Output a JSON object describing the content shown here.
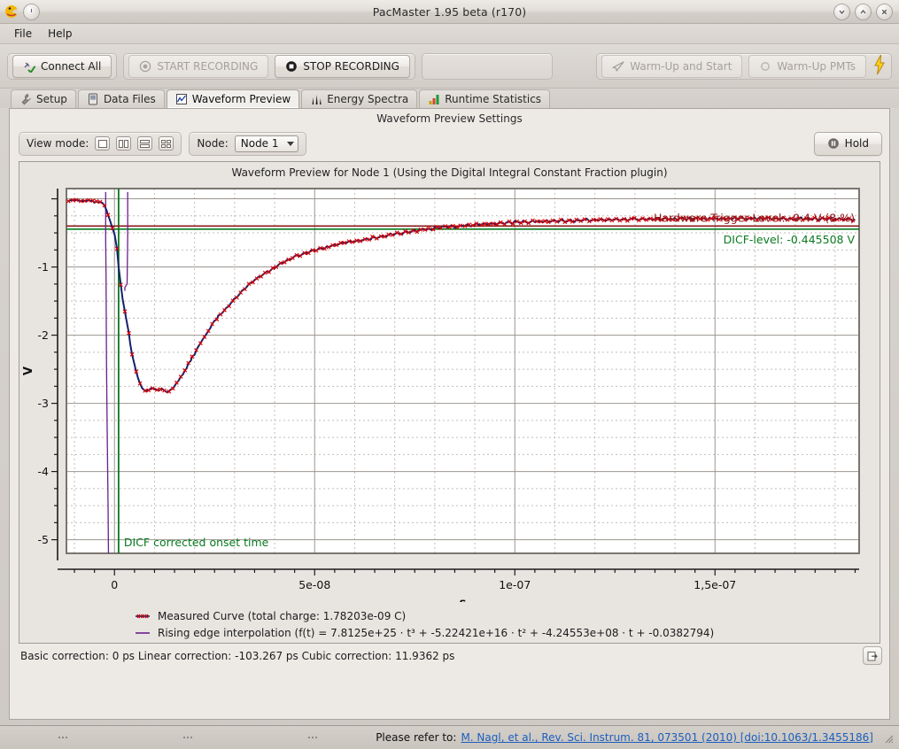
{
  "window": {
    "title": "PacMaster 1.95 beta (r170)",
    "app_icon": "pacman-icon",
    "controls": [
      {
        "name": "minimize-button",
        "glyph": "⌄"
      },
      {
        "name": "maximize-button",
        "glyph": "⌃"
      },
      {
        "name": "close-button",
        "glyph": "✕"
      }
    ]
  },
  "menubar": {
    "items": [
      {
        "name": "menu-file",
        "label": "File"
      },
      {
        "name": "menu-help",
        "label": "Help"
      }
    ]
  },
  "toolbar": {
    "connect_all": {
      "label": "Connect All",
      "icon": "plug-check-icon",
      "enabled": true
    },
    "start_recording": {
      "label": "START RECORDING",
      "icon": "record-circle-icon",
      "enabled": false
    },
    "stop_recording": {
      "label": "STOP RECORDING",
      "icon": "stop-square-icon",
      "enabled": true
    },
    "warm_up_and_start": {
      "label": "Warm-Up and Start",
      "icon": "paper-plane-icon",
      "enabled": false
    },
    "warm_up_pmts": {
      "label": "Warm-Up PMTs",
      "icon": "circle-icon",
      "enabled": false
    },
    "bolt": {
      "name": "lightning-bolt-icon",
      "glyph": "⚡",
      "color": "#f5c518"
    }
  },
  "tabs": [
    {
      "name": "tab-setup",
      "label": "Setup",
      "icon": "wrench-icon",
      "active": false
    },
    {
      "name": "tab-data-files",
      "label": "Data Files",
      "icon": "document-icon",
      "active": false
    },
    {
      "name": "tab-waveform-preview",
      "label": "Waveform Preview",
      "icon": "line-chart-icon",
      "active": true
    },
    {
      "name": "tab-energy-spectra",
      "label": "Energy Spectra",
      "icon": "spectrum-icon",
      "active": false
    },
    {
      "name": "tab-runtime-statistics",
      "label": "Runtime Statistics",
      "icon": "bar-chart-icon",
      "active": false
    }
  ],
  "settings": {
    "panel_title": "Waveform Preview Settings",
    "view_mode_label": "View mode:",
    "view_modes": [
      {
        "name": "view-mode-single",
        "selected": true
      },
      {
        "name": "view-mode-two-columns",
        "selected": false
      },
      {
        "name": "view-mode-two-rows",
        "selected": false
      },
      {
        "name": "view-mode-quad",
        "selected": false
      }
    ],
    "node_label": "Node:",
    "node_value": "Node 1",
    "hold_label": "Hold",
    "hold_icon": "pause-icon"
  },
  "plot": {
    "title": "Waveform Preview for Node 1 (Using the Digital Integral Constant Fraction plugin)",
    "annotations": {
      "hardware_trigger": "Hardware Trigger Level: -0.4 V (8 %)",
      "dicf_level": "DICF-level: -0.445508 V",
      "onset": "DICF corrected onset time"
    },
    "legend": [
      {
        "name": "legend-measured-curve",
        "key": "points-line-key",
        "label": "Measured Curve (total charge: 1.78203e-09 C)"
      },
      {
        "name": "legend-rising-edge",
        "key": "line-key",
        "label": "Rising edge interpolation (f(t) =  7.8125e+25 · t³ + -5.22421e+16 · t² + -4.24553e+08 · t + -0.0382794)"
      }
    ]
  },
  "chart_data": {
    "type": "line",
    "title": "Waveform Preview for Node 1 (Using the Digital Integral Constant Fraction plugin)",
    "xlabel": "s",
    "ylabel": "V",
    "xlim": [
      -1.2e-08,
      1.86e-07
    ],
    "ylim": [
      -5.2,
      0.15
    ],
    "grid": true,
    "legend_position": "below",
    "xticks": [
      {
        "value": 0,
        "label": "0"
      },
      {
        "value": 5e-08,
        "label": "5e-08"
      },
      {
        "value": 1e-07,
        "label": "1e-07"
      },
      {
        "value": 1.5e-07,
        "label": "1,5e-07"
      }
    ],
    "yticks": [
      {
        "value": -1,
        "label": "-1"
      },
      {
        "value": -2,
        "label": "-2"
      },
      {
        "value": -3,
        "label": "-3"
      },
      {
        "value": -4,
        "label": "-4"
      },
      {
        "value": -5,
        "label": "-5"
      }
    ],
    "hlines": [
      {
        "name": "hardware-trigger-level",
        "value": -0.4,
        "color": "#8b1a1a",
        "label": "Hardware Trigger Level: -0.4 V (8 %)"
      },
      {
        "name": "dicf-level",
        "value": -0.445508,
        "color": "#0a7a20",
        "label": "DICF-level: -0.445508 V"
      }
    ],
    "vlines": [
      {
        "name": "dicf-corrected-onset-time",
        "value": 1.03e-09,
        "color": "#0a7a20",
        "label": "DICF corrected onset time"
      }
    ],
    "series": [
      {
        "name": "Measured Curve",
        "color": "#cc0000",
        "marker": "x",
        "total_charge": "1.78203e-09 C",
        "x": [
          -1.15e-08,
          -1.05e-08,
          -9.5e-09,
          -8.5e-09,
          -7.5e-09,
          -6.5e-09,
          -5.5e-09,
          -4.5e-09,
          -3.5e-09,
          -3e-09,
          -2.5e-09,
          -2e-09,
          -1.5e-09,
          -1e-09,
          -5e-10,
          0.0,
          5e-10,
          1e-09,
          1.5e-09,
          2e-09,
          2.5e-09,
          3e-09,
          3.5e-09,
          4e-09,
          4.5e-09,
          5e-09,
          5.5e-09,
          6e-09,
          6.5e-09,
          7e-09,
          7.5e-09,
          8e-09,
          8.5e-09,
          9e-09,
          9.5e-09,
          1e-08,
          1.05e-08,
          1.1e-08,
          1.15e-08,
          1.2e-08,
          1.25e-08,
          1.3e-08,
          1.4e-08,
          1.5e-08,
          1.6e-08,
          1.7e-08,
          1.8e-08,
          1.9e-08,
          2e-08,
          2.1e-08,
          2.2e-08,
          2.3e-08,
          2.4e-08,
          2.5e-08,
          2.6e-08,
          2.8e-08,
          3e-08,
          3.2e-08,
          3.4e-08,
          3.6e-08,
          3.8e-08,
          4e-08,
          4.2e-08,
          4.4e-08,
          4.6e-08,
          4.8e-08,
          5e-08,
          5.4e-08,
          5.8e-08,
          6.2e-08,
          6.6e-08,
          7e-08,
          7.4e-08,
          7.8e-08,
          8.2e-08,
          8.6e-08,
          9e-08,
          9.6e-08,
          1.02e-07,
          1.08e-07,
          1.14e-07,
          1.2e-07,
          1.3e-07,
          1.4e-07,
          1.5e-07,
          1.6e-07,
          1.7e-07,
          1.8e-07,
          1.85e-07
        ],
        "y": [
          -0.035,
          -0.034,
          -0.036,
          -0.035,
          -0.034,
          -0.036,
          -0.037,
          -0.04,
          -0.05,
          -0.07,
          -0.11,
          -0.17,
          -0.25,
          -0.33,
          -0.42,
          -0.52,
          -0.72,
          -1.0,
          -1.25,
          -1.47,
          -1.64,
          -1.8,
          -1.96,
          -2.12,
          -2.28,
          -2.42,
          -2.54,
          -2.64,
          -2.72,
          -2.79,
          -2.83,
          -2.835,
          -2.82,
          -2.8,
          -2.79,
          -2.8,
          -2.81,
          -2.8,
          -2.785,
          -2.78,
          -2.8,
          -2.82,
          -2.8,
          -2.74,
          -2.66,
          -2.57,
          -2.47,
          -2.37,
          -2.27,
          -2.17,
          -2.08,
          -1.99,
          -1.9,
          -1.81,
          -1.73,
          -1.6,
          -1.47,
          -1.35,
          -1.24,
          -1.15,
          -1.08,
          -1.01,
          -0.94,
          -0.88,
          -0.83,
          -0.79,
          -0.76,
          -0.69,
          -0.64,
          -0.6,
          -0.56,
          -0.52,
          -0.48,
          -0.45,
          -0.42,
          -0.4,
          -0.38,
          -0.36,
          -0.34,
          -0.33,
          -0.32,
          -0.31,
          -0.3,
          -0.295,
          -0.29,
          -0.29,
          -0.292,
          -0.3,
          -0.305
        ]
      },
      {
        "name": "Rising edge interpolation",
        "color": "#14206b",
        "marker": "none",
        "formula": "f(t) =  7.8125e+25 · t³ + -5.22421e+16 · t² + -4.24553e+08 · t + -0.0382794",
        "coefficients": {
          "t3": 7.8125e+25,
          "t2": -5.22421e+16,
          "t1": -424553000.0,
          "t0": -0.0382794
        }
      },
      {
        "name": "DICF integral trace",
        "color": "#6b1f8c",
        "marker": "none"
      }
    ]
  },
  "status": {
    "corrections": "Basic correction: 0 ps Linear correction: -103.267 ps Cubic correction: 11.9362 ps",
    "export_icon": "export-page-icon"
  },
  "footer": {
    "prefix": "Please refer to:",
    "link": "M. Nagl, et al., Rev. Sci. Instrum. 81, 073501 (2010) [doi:10.1063/1.3455186]"
  }
}
